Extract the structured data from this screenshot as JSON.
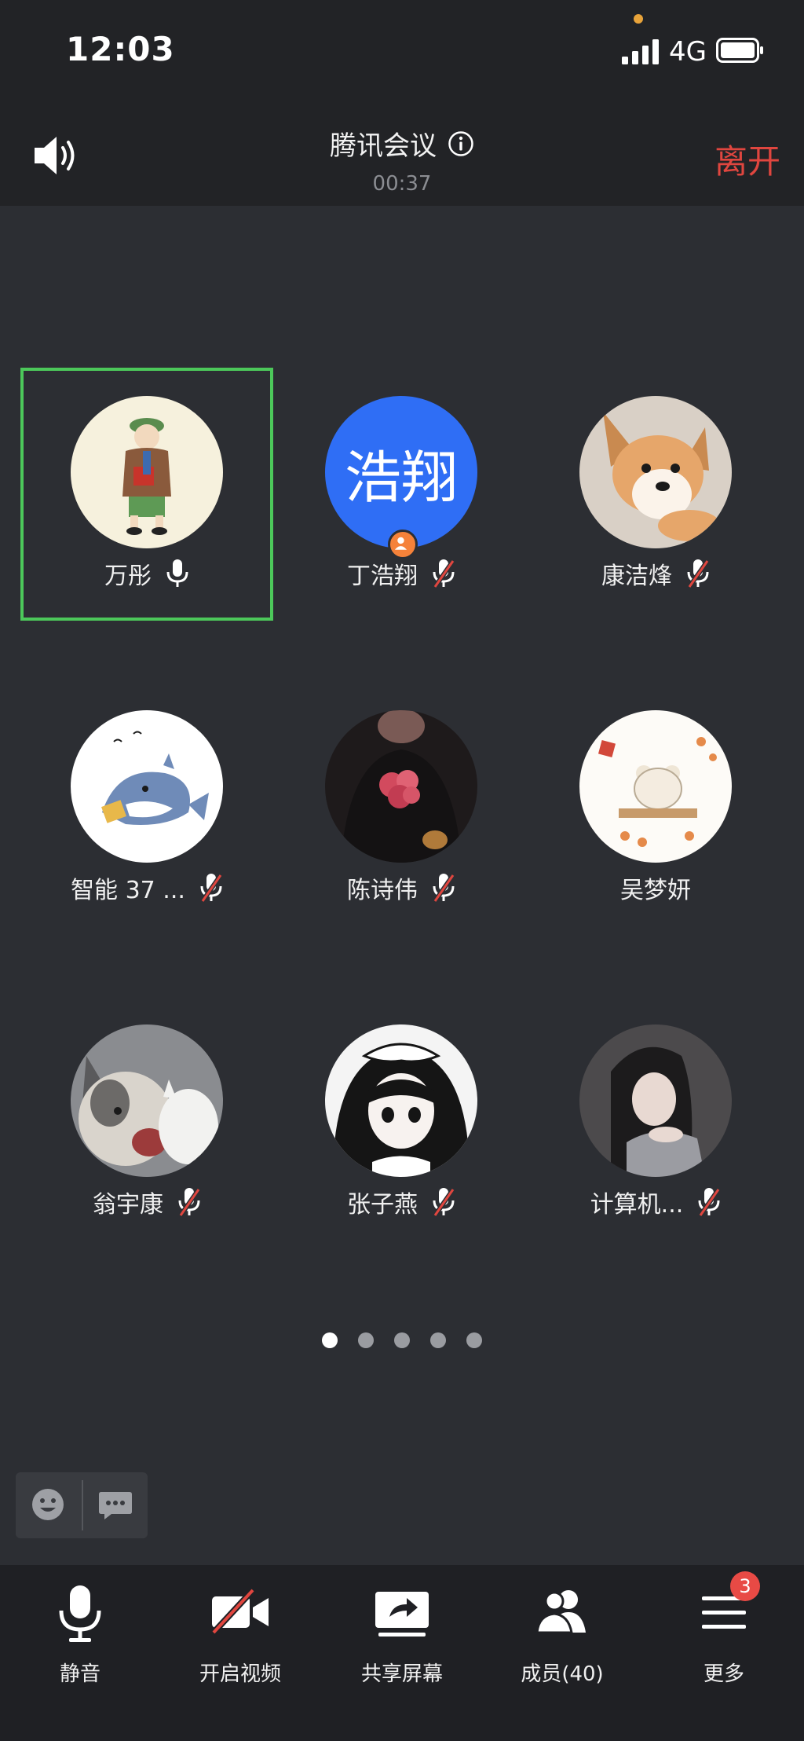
{
  "status_bar": {
    "time": "12:03",
    "network": "4G"
  },
  "header": {
    "title": "腾讯会议",
    "timer": "00:37",
    "leave_label": "离开"
  },
  "participants": [
    {
      "name": "万彤",
      "mic": "on",
      "active": true,
      "avatar": "cartoon-boy-avatar"
    },
    {
      "name": "丁浩翔",
      "mic": "muted",
      "avatar_text": "浩翔",
      "avatar_color": "#2f6ef5",
      "is_host": true
    },
    {
      "name": "康洁烽",
      "mic": "muted",
      "avatar": "corgi-photo-avatar"
    },
    {
      "name": "智能 37 ...",
      "mic": "muted",
      "avatar": "shark-drawing-avatar"
    },
    {
      "name": "陈诗伟",
      "mic": "muted",
      "avatar": "flowers-photo-avatar"
    },
    {
      "name": "吴梦妍",
      "mic": "none",
      "avatar": "bear-drawing-avatar"
    },
    {
      "name": "翁宇康",
      "mic": "muted",
      "avatar": "husky-cat-photo-avatar"
    },
    {
      "name": "张子燕",
      "mic": "muted",
      "avatar": "anime-maid-avatar"
    },
    {
      "name": "计算机...",
      "mic": "muted",
      "avatar": "girl-photo-avatar"
    }
  ],
  "pagination": {
    "pages": 5,
    "current": 1
  },
  "toolbar": {
    "mute_label": "静音",
    "video_label": "开启视频",
    "share_label": "共享屏幕",
    "members_label": "成员(40)",
    "more_label": "更多",
    "more_badge": "3"
  },
  "colors": {
    "leave": "#e0463f",
    "active_border": "#4cc85a",
    "muted_slash": "#e0463f",
    "host_badge": "#f5823a",
    "notification_badge": "#e84a45"
  }
}
